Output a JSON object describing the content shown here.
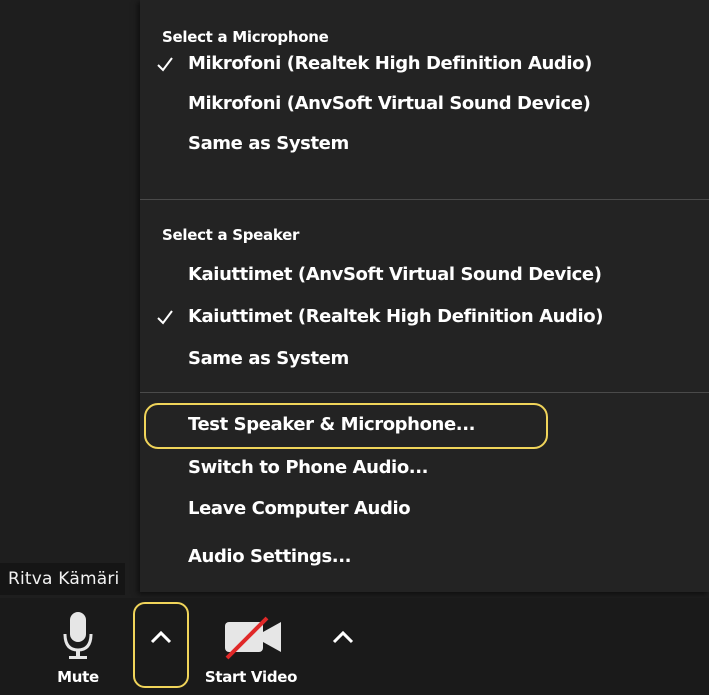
{
  "participant": {
    "name": "Ritva Kämäri"
  },
  "audio_menu": {
    "microphone_section": {
      "header": "Select a Microphone",
      "items": [
        {
          "label": "Mikrofoni (Realtek High Definition Audio)",
          "checked": true
        },
        {
          "label": "Mikrofoni (AnvSoft Virtual Sound Device)",
          "checked": false
        },
        {
          "label": "Same as System",
          "checked": false
        }
      ]
    },
    "speaker_section": {
      "header": "Select a Speaker",
      "items": [
        {
          "label": "Kaiuttimet (AnvSoft Virtual Sound Device)",
          "checked": false
        },
        {
          "label": "Kaiuttimet (Realtek High Definition Audio)",
          "checked": true
        },
        {
          "label": "Same as System",
          "checked": false
        }
      ]
    },
    "actions": [
      {
        "label": "Test Speaker & Microphone...",
        "highlighted": true
      },
      {
        "label": "Switch to Phone Audio..."
      },
      {
        "label": "Leave Computer Audio"
      },
      {
        "label": "Audio Settings..."
      }
    ]
  },
  "toolbar": {
    "mute_label": "Mute",
    "start_video_label": "Start Video"
  },
  "colors": {
    "menu_bg": "#232323",
    "toolbar_bg": "#1a1a1a",
    "highlight": "#f0d45a",
    "video_off_slash": "#e02828",
    "text": "#ffffff"
  },
  "icons": {
    "check": "check-icon",
    "microphone": "microphone-icon",
    "video_off": "video-off-icon",
    "chevron_up": "chevron-up-icon"
  }
}
